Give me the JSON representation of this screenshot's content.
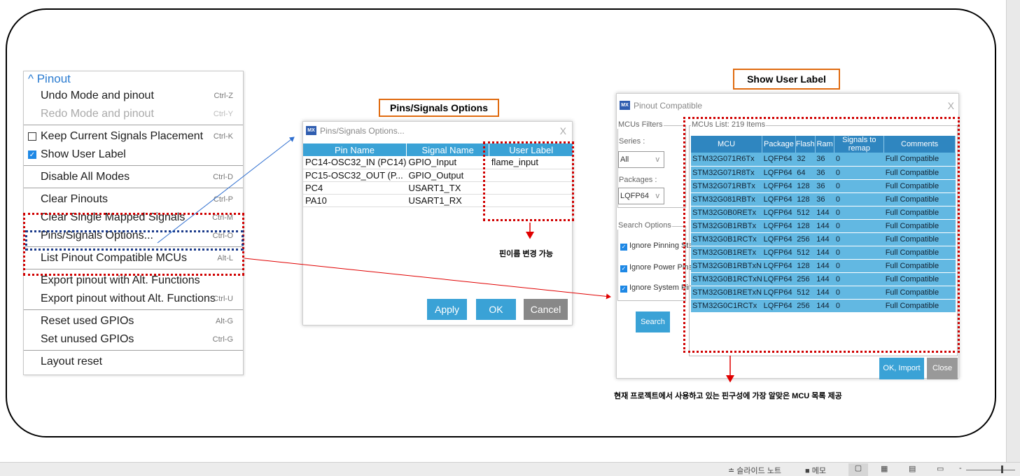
{
  "menu": {
    "header": "Pinout",
    "items": [
      {
        "label": "Undo Mode and pinout",
        "shortcut": "Ctrl-Z"
      },
      {
        "label": "Redo Mode and pinout",
        "shortcut": "Ctrl-Y"
      },
      {
        "label": "Keep Current Signals Placement",
        "shortcut": "Ctrl-K"
      },
      {
        "label": "Show User Label",
        "shortcut": ""
      },
      {
        "label": "Disable All Modes",
        "shortcut": "Ctrl-D"
      },
      {
        "label": "Clear Pinouts",
        "shortcut": "Ctrl-P"
      },
      {
        "label": "Clear Single Mapped Signals",
        "shortcut": "Ctrl-M"
      },
      {
        "label": "Pins/Signals Options...",
        "shortcut": "Ctrl-O"
      },
      {
        "label": "List Pinout Compatible MCUs",
        "shortcut": "Alt-L"
      },
      {
        "label": "Export pinout with Alt. Functions",
        "shortcut": ""
      },
      {
        "label": "Export pinout without Alt. Functions",
        "shortcut": "Ctrl-U"
      },
      {
        "label": "Reset used GPIOs",
        "shortcut": "Alt-G"
      },
      {
        "label": "Set unused GPIOs",
        "shortcut": "Ctrl-G"
      },
      {
        "label": "Layout reset",
        "shortcut": ""
      }
    ]
  },
  "labels": {
    "pins_box": "Pins/Signals Options",
    "user_box": "Show User Label",
    "note1": "핀이름 변경 가능",
    "note2": "현재 프로젝트에서 사용하고 있는 핀구성에 가장  알맞은 MCU 목록 제공"
  },
  "dialog1": {
    "logo": "MX",
    "title": "Pins/Signals Options...",
    "close": "X",
    "headers": [
      "Pin Name",
      "Signal Name",
      "User Label"
    ],
    "rows": [
      [
        "PC14-OSC32_IN (PC14)",
        "GPIO_Input",
        "flame_input"
      ],
      [
        "PC15-OSC32_OUT (P...",
        "GPIO_Output",
        ""
      ],
      [
        "PC4",
        "USART1_TX",
        ""
      ],
      [
        "PA10",
        "USART1_RX",
        ""
      ]
    ],
    "apply": "Apply",
    "ok": "OK",
    "cancel": "Cancel"
  },
  "dialog2": {
    "logo": "MX",
    "title": "Pinout Compatible",
    "close": "X",
    "filters": "MCUs Filters",
    "series_label": "Series :",
    "series_value": "All",
    "packages_label": "Packages :",
    "packages_value": "LQFP64",
    "search_options": "Search Options",
    "cb1": "Ignore Pinning Status",
    "cb2": "Ignore Power Pins",
    "cb3": "Ignore System Pins",
    "search": "Search",
    "list_label": "MCUs List: 219 Items",
    "headers": [
      "MCU",
      "Package",
      "Flash",
      "Ram",
      "Signals to remap",
      "Comments"
    ],
    "rows": [
      [
        "STM32G071R6Tx",
        "LQFP64",
        "32",
        "36",
        "0",
        "Full Compatible"
      ],
      [
        "STM32G071R8Tx",
        "LQFP64",
        "64",
        "36",
        "0",
        "Full Compatible"
      ],
      [
        "STM32G071RBTx",
        "LQFP64",
        "128",
        "36",
        "0",
        "Full Compatible"
      ],
      [
        "STM32G081RBTx",
        "LQFP64",
        "128",
        "36",
        "0",
        "Full Compatible"
      ],
      [
        "STM32G0B0RETx",
        "LQFP64",
        "512",
        "144",
        "0",
        "Full Compatible"
      ],
      [
        "STM32G0B1RBTx",
        "LQFP64",
        "128",
        "144",
        "0",
        "Full Compatible"
      ],
      [
        "STM32G0B1RCTx",
        "LQFP64",
        "256",
        "144",
        "0",
        "Full Compatible"
      ],
      [
        "STM32G0B1RETx",
        "LQFP64",
        "512",
        "144",
        "0",
        "Full Compatible"
      ],
      [
        "STM32G0B1RBTxN",
        "LQFP64",
        "128",
        "144",
        "0",
        "Full Compatible"
      ],
      [
        "STM32G0B1RCTxN",
        "LQFP64",
        "256",
        "144",
        "0",
        "Full Compatible"
      ],
      [
        "STM32G0B1RETxN",
        "LQFP64",
        "512",
        "144",
        "0",
        "Full Compatible"
      ],
      [
        "STM32G0C1RCTx",
        "LQFP64",
        "256",
        "144",
        "0",
        "Full Compatible"
      ]
    ],
    "ok_import": "OK, Import",
    "close_btn": "Close"
  },
  "status": {
    "notes": "슬라이드 노트",
    "memo": "메모"
  }
}
